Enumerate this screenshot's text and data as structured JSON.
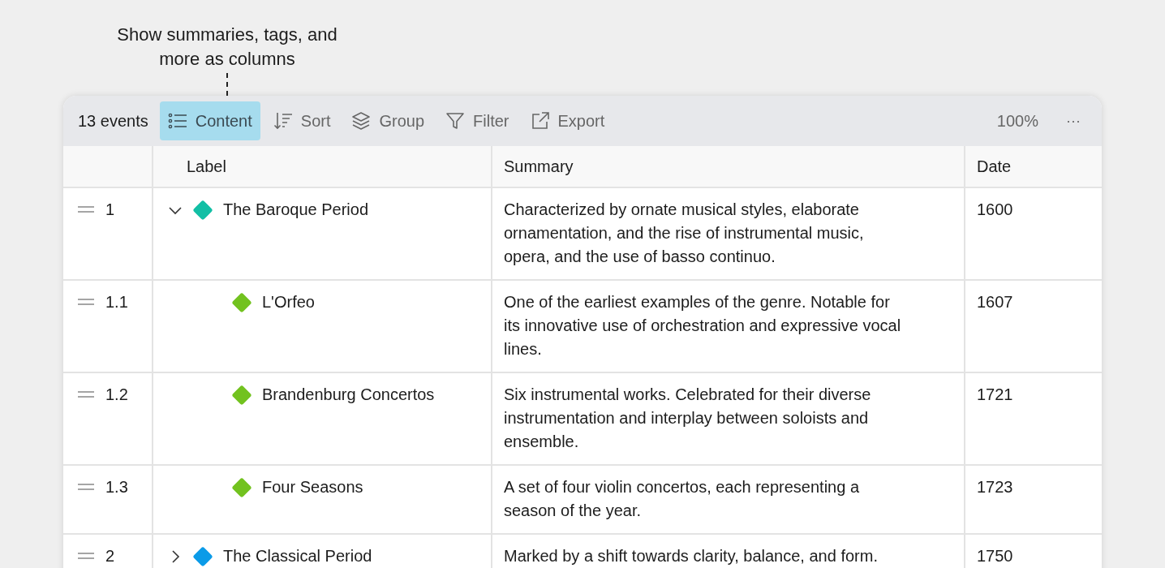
{
  "callout": "Show summaries, tags, and more as columns",
  "toolbar": {
    "count": "13 events",
    "buttons": [
      {
        "label": "Content",
        "selected": true
      },
      {
        "label": "Sort",
        "selected": false
      },
      {
        "label": "Group",
        "selected": false
      },
      {
        "label": "Filter",
        "selected": false
      },
      {
        "label": "Export",
        "selected": false
      }
    ],
    "zoom": "100%",
    "more": "···"
  },
  "table": {
    "columns": [
      "Label",
      "Summary",
      "Date"
    ],
    "rows": [
      {
        "number": "1",
        "label": "The Baroque Period",
        "color": "#12bfa5",
        "expanded": true,
        "summary": "Characterized by ornate musical styles, elaborate ornamentation, and the rise of instrumental music, opera, and the use of basso continuo.",
        "date": "1600",
        "children": [
          {
            "number": "1.1",
            "label": "L'Orfeo",
            "color": "#72c21f",
            "summary": "One of the earliest examples of the genre. Notable for its innovative use of orchestration and expressive vocal lines.",
            "date": "1607"
          },
          {
            "number": "1.2",
            "label": "Brandenburg Concertos",
            "color": "#72c21f",
            "summary": "Six instrumental works. Celebrated for their diverse instrumentation and interplay between soloists and ensemble.",
            "date": "1721"
          },
          {
            "number": "1.3",
            "label": "Four Seasons",
            "color": "#72c21f",
            "summary": "A set of four violin concertos, each representing a season of the year.",
            "date": "1723"
          }
        ]
      },
      {
        "number": "2",
        "label": "The Classical Period",
        "color": "#0b9be8",
        "expanded": false,
        "summary": "Marked by a shift towards clarity, balance, and form.",
        "date": "1750"
      }
    ]
  }
}
